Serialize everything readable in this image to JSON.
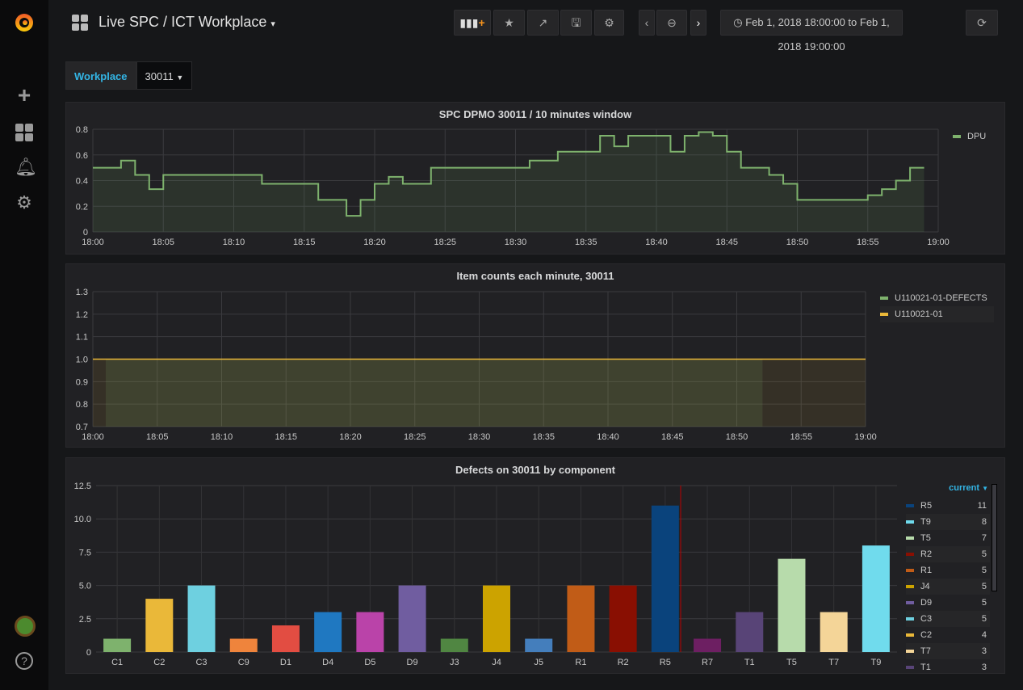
{
  "header": {
    "title": "Live SPC / ICT Workplace",
    "time_range": "Feb 1, 2018 18:00:00 to Feb 1, 2018 19:00:00"
  },
  "icons": {
    "logo": "grafana-logo",
    "sidebar": [
      "plus-icon",
      "dashboards-icon",
      "bell-icon",
      "gear-icon"
    ],
    "toolbar": [
      "add-panel-icon",
      "star-icon",
      "share-icon",
      "save-icon",
      "settings-icon",
      "chevron-left-icon",
      "zoom-out-icon",
      "chevron-right-icon",
      "clock-icon",
      "refresh-icon"
    ],
    "help": "?"
  },
  "variables": {
    "label": "Workplace",
    "value": "30011"
  },
  "chart_data": [
    {
      "type": "line",
      "title": "SPC DPMO 30011 / 10 minutes window",
      "step": true,
      "fill": true,
      "x_ticks": [
        "18:00",
        "18:05",
        "18:10",
        "18:15",
        "18:20",
        "18:25",
        "18:30",
        "18:35",
        "18:40",
        "18:45",
        "18:50",
        "18:55",
        "19:00"
      ],
      "y_ticks": [
        "0",
        "0.2",
        "0.4",
        "0.6",
        "0.8"
      ],
      "ylim": [
        0,
        0.8
      ],
      "legend": "right",
      "grid": true,
      "series": [
        {
          "name": "DPU",
          "color": "#7eb26d",
          "points": [
            [
              "18:00",
              0.5
            ],
            [
              "18:02",
              0.556
            ],
            [
              "18:03",
              0.444
            ],
            [
              "18:04",
              0.333
            ],
            [
              "18:05",
              0.444
            ],
            [
              "18:12",
              0.375
            ],
            [
              "18:16",
              0.25
            ],
            [
              "18:18",
              0.125
            ],
            [
              "18:19",
              0.25
            ],
            [
              "18:20",
              0.375
            ],
            [
              "18:21",
              0.429
            ],
            [
              "18:22",
              0.375
            ],
            [
              "18:24",
              0.5
            ],
            [
              "18:31",
              0.556
            ],
            [
              "18:33",
              0.625
            ],
            [
              "18:36",
              0.75
            ],
            [
              "18:37",
              0.667
            ],
            [
              "18:38",
              0.75
            ],
            [
              "18:41",
              0.625
            ],
            [
              "18:42",
              0.75
            ],
            [
              "18:43",
              0.778
            ],
            [
              "18:44",
              0.75
            ],
            [
              "18:45",
              0.625
            ],
            [
              "18:46",
              0.5
            ],
            [
              "18:48",
              0.444
            ],
            [
              "18:49",
              0.375
            ],
            [
              "18:50",
              0.25
            ],
            [
              "18:55",
              0.286
            ],
            [
              "18:56",
              0.333
            ],
            [
              "18:57",
              0.4
            ],
            [
              "18:58",
              0.5
            ],
            [
              "18:59",
              0.5
            ]
          ]
        }
      ]
    },
    {
      "type": "area",
      "title": "Item counts each minute, 30011",
      "x_ticks": [
        "18:00",
        "18:05",
        "18:10",
        "18:15",
        "18:20",
        "18:25",
        "18:30",
        "18:35",
        "18:40",
        "18:45",
        "18:50",
        "18:55",
        "19:00"
      ],
      "y_ticks": [
        "0.7",
        "0.8",
        "0.9",
        "1.0",
        "1.1",
        "1.2",
        "1.3"
      ],
      "ylim": [
        0.7,
        1.3
      ],
      "legend": "right",
      "grid": true,
      "series": [
        {
          "name": "U110021-01-DEFECTS",
          "color": "#7eb26d",
          "from": "18:01",
          "to": "18:52",
          "value": 1.0
        },
        {
          "name": "U110021-01",
          "color": "#eab839",
          "from": "18:00",
          "to": "19:00",
          "value": 1.0
        }
      ]
    },
    {
      "type": "bar",
      "title": "Defects on 30011 by component",
      "legend": "right",
      "legend_header": "current",
      "ylim": [
        0,
        12.5
      ],
      "y_ticks": [
        "0",
        "2.5",
        "5.0",
        "7.5",
        "10.0",
        "12.5"
      ],
      "categories": [
        "C1",
        "C2",
        "C3",
        "C9",
        "D1",
        "D4",
        "D5",
        "D9",
        "J3",
        "J4",
        "J5",
        "R1",
        "R2",
        "R5",
        "R7",
        "T1",
        "T5",
        "T7",
        "T9"
      ],
      "values": [
        1,
        4,
        5,
        1,
        2,
        3,
        3,
        5,
        1,
        5,
        1,
        5,
        5,
        11,
        1,
        3,
        7,
        3,
        8
      ],
      "colors": [
        "#7eb26d",
        "#eab839",
        "#6ed0e0",
        "#ef843c",
        "#e24d42",
        "#1f78c1",
        "#ba43a9",
        "#705da0",
        "#508642",
        "#cca300",
        "#447ebc",
        "#c15c17",
        "#890f02",
        "#0a437c",
        "#6d1f62",
        "#584477",
        "#b7dbab",
        "#f4d598",
        "#70dbed"
      ],
      "legend_items": [
        [
          "R5",
          11,
          "#0a437c"
        ],
        [
          "T9",
          8,
          "#70dbed"
        ],
        [
          "T5",
          7,
          "#b7dbab"
        ],
        [
          "R2",
          5,
          "#890f02"
        ],
        [
          "R1",
          5,
          "#c15c17"
        ],
        [
          "J4",
          5,
          "#cca300"
        ],
        [
          "D9",
          5,
          "#705da0"
        ],
        [
          "C3",
          5,
          "#6ed0e0"
        ],
        [
          "C2",
          4,
          "#eab839"
        ],
        [
          "T7",
          3,
          "#f4d598"
        ],
        [
          "T1",
          3,
          "#584477"
        ]
      ]
    }
  ]
}
